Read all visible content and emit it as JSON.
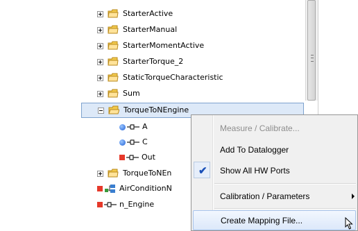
{
  "tree": {
    "items": [
      {
        "label": "StarterActive"
      },
      {
        "label": "StarterManual"
      },
      {
        "label": "StarterMomentActive"
      },
      {
        "label": "StarterTorque_2"
      },
      {
        "label": "StaticTorqueCharacteristic"
      },
      {
        "label": "Sum"
      },
      {
        "label": "TorqueToNEngine"
      },
      {
        "label": "A"
      },
      {
        "label": "C"
      },
      {
        "label": "Out"
      },
      {
        "label": "TorqueToNEn"
      },
      {
        "label": "AirConditionN"
      },
      {
        "label": "n_Engine"
      }
    ]
  },
  "context_menu": {
    "items": [
      {
        "label": "Measure / Calibrate..."
      },
      {
        "label": "Add To Datalogger"
      },
      {
        "label": "Show All HW Ports",
        "checked": true
      },
      {
        "label": "Calibration / Parameters"
      },
      {
        "label": "Create Mapping File..."
      }
    ]
  },
  "colors": {
    "selection_bg": "#dde9f8",
    "selection_border": "#7da2ce",
    "check": "#1a50b8",
    "port_out": "#e6392a",
    "port_in": "#1f5fd6",
    "folder": "#f2c94c"
  },
  "icons": [
    "folder-icon",
    "expand-plus-icon",
    "collapse-minus-icon",
    "inport-icon",
    "outport-icon",
    "subsystem-icon",
    "checkmark-icon",
    "submenu-arrow-icon",
    "mouse-cursor-icon"
  ]
}
